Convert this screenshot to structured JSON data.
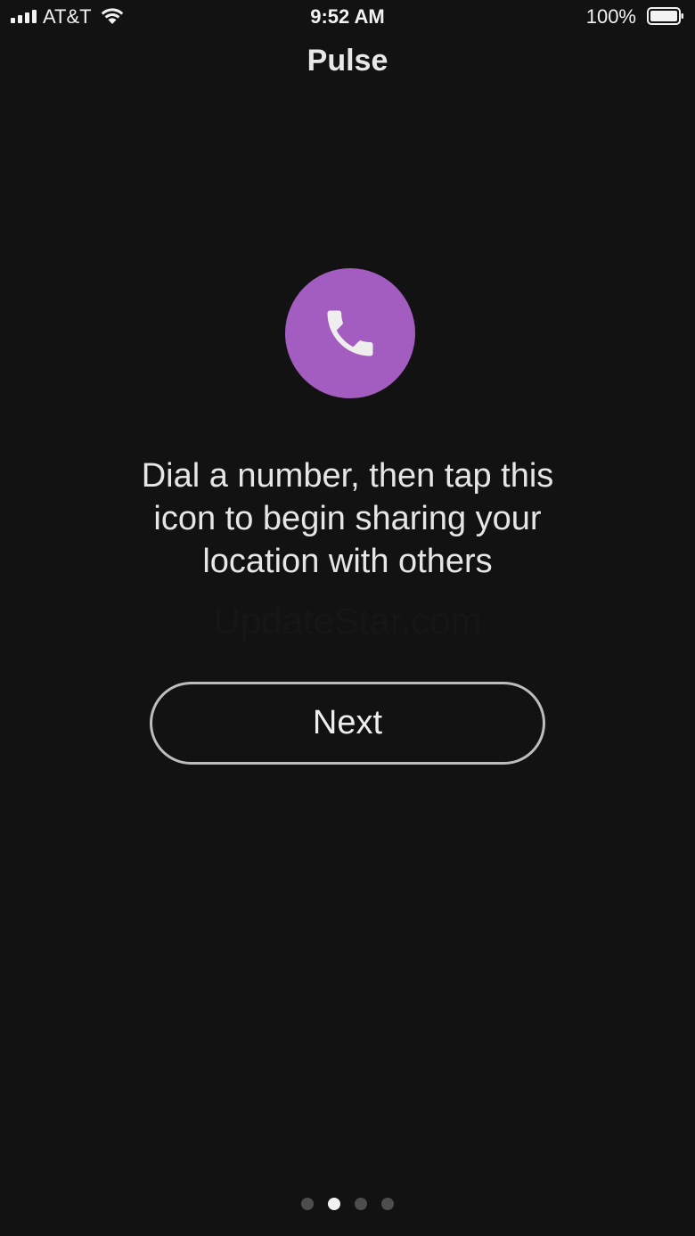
{
  "status_bar": {
    "carrier": "AT&T",
    "time": "9:52 AM",
    "battery_percent": "100%"
  },
  "nav": {
    "title": "Pulse"
  },
  "hero": {
    "icon": "phone-icon",
    "icon_bg_color": "#a35cc0",
    "message": "Dial a number, then tap this icon to begin sharing your location with others"
  },
  "watermark": {
    "text": "UpdateStar.com"
  },
  "next_button": {
    "label": "Next"
  },
  "pager": {
    "total": 4,
    "active_index": 1
  }
}
